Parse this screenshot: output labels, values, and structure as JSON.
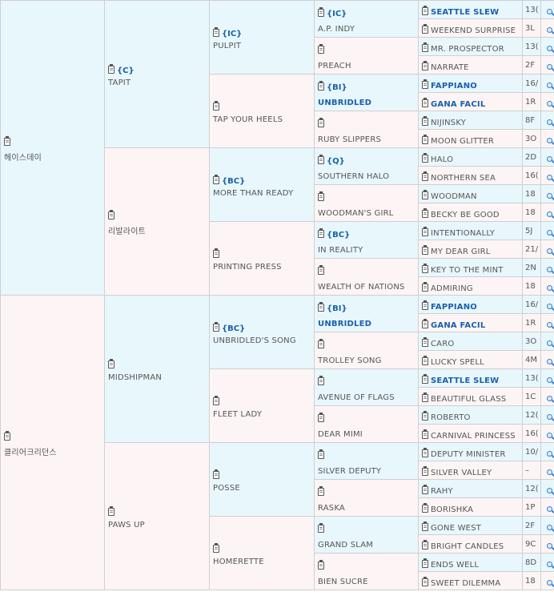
{
  "gen1": [
    {
      "name": "헤이스데이",
      "tag": "",
      "sex": "m"
    },
    {
      "name": "클리어크리던스",
      "tag": "",
      "sex": "f"
    }
  ],
  "gen2": [
    {
      "name": "TAPIT",
      "tag": "{C}",
      "sex": "m"
    },
    {
      "name": "리발라이트",
      "tag": "",
      "sex": "f"
    },
    {
      "name": "MIDSHIPMAN",
      "tag": "",
      "sex": "m"
    },
    {
      "name": "PAWS UP",
      "tag": "",
      "sex": "f"
    }
  ],
  "gen3": [
    {
      "name": "PULPIT",
      "tag": "{IC}",
      "sex": "m"
    },
    {
      "name": "TAP YOUR HEELS",
      "tag": "",
      "sex": "f"
    },
    {
      "name": "MORE THAN READY",
      "tag": "{BC}",
      "sex": "m"
    },
    {
      "name": "PRINTING PRESS",
      "tag": "",
      "sex": "f"
    },
    {
      "name": "UNBRIDLED'S SONG",
      "tag": "{BC}",
      "sex": "m"
    },
    {
      "name": "FLEET LADY",
      "tag": "",
      "sex": "f"
    },
    {
      "name": "POSSE",
      "tag": "",
      "sex": "m"
    },
    {
      "name": "HOMERETTE",
      "tag": "",
      "sex": "f"
    }
  ],
  "gen4": [
    {
      "name": "A.P. INDY",
      "tag": "{IC}",
      "sex": "m",
      "blue": false
    },
    {
      "name": "PREACH",
      "tag": "",
      "sex": "f",
      "blue": false
    },
    {
      "name": "UNBRIDLED",
      "tag": "{BI}",
      "sex": "m",
      "blue": true
    },
    {
      "name": "RUBY SLIPPERS",
      "tag": "",
      "sex": "f",
      "blue": false
    },
    {
      "name": "SOUTHERN HALO",
      "tag": "{Q}",
      "sex": "m",
      "blue": false
    },
    {
      "name": "WOODMAN'S GIRL",
      "tag": "",
      "sex": "f",
      "blue": false
    },
    {
      "name": "IN REALITY",
      "tag": "{BC}",
      "sex": "m",
      "blue": false
    },
    {
      "name": "WEALTH OF NATIONS",
      "tag": "",
      "sex": "f",
      "blue": false
    },
    {
      "name": "UNBRIDLED",
      "tag": "{BI}",
      "sex": "m",
      "blue": true
    },
    {
      "name": "TROLLEY SONG",
      "tag": "",
      "sex": "f",
      "blue": false
    },
    {
      "name": "AVENUE OF FLAGS",
      "tag": "",
      "sex": "m",
      "blue": false
    },
    {
      "name": "DEAR MIMI",
      "tag": "",
      "sex": "f",
      "blue": false
    },
    {
      "name": "SILVER DEPUTY",
      "tag": "",
      "sex": "m",
      "blue": false
    },
    {
      "name": "RASKA",
      "tag": "",
      "sex": "f",
      "blue": false
    },
    {
      "name": "GRAND SLAM",
      "tag": "",
      "sex": "m",
      "blue": false
    },
    {
      "name": "BIEN SUCRE",
      "tag": "",
      "sex": "f",
      "blue": false
    }
  ],
  "gen5": [
    {
      "name": "SEATTLE SLEW",
      "rec": "13(",
      "sex": "m",
      "blue": true
    },
    {
      "name": "WEEKEND SURPRISE",
      "rec": "3L",
      "sex": "f",
      "blue": false
    },
    {
      "name": "MR. PROSPECTOR",
      "rec": "13(",
      "sex": "m",
      "blue": false
    },
    {
      "name": "NARRATE",
      "rec": "2F",
      "sex": "f",
      "blue": false
    },
    {
      "name": "FAPPIANO",
      "rec": "16/",
      "sex": "m",
      "blue": true
    },
    {
      "name": "GANA FACIL",
      "rec": "1R",
      "sex": "f",
      "blue": true
    },
    {
      "name": "NIJINSKY",
      "rec": "8F",
      "sex": "m",
      "blue": false
    },
    {
      "name": "MOON GLITTER",
      "rec": "3O",
      "sex": "f",
      "blue": false
    },
    {
      "name": "HALO",
      "rec": "2D",
      "sex": "m",
      "blue": false
    },
    {
      "name": "NORTHERN SEA",
      "rec": "16(",
      "sex": "f",
      "blue": false
    },
    {
      "name": "WOODMAN",
      "rec": "18",
      "sex": "m",
      "blue": false
    },
    {
      "name": "BECKY BE GOOD",
      "rec": "18",
      "sex": "f",
      "blue": false
    },
    {
      "name": "INTENTIONALLY",
      "rec": "5J",
      "sex": "m",
      "blue": false
    },
    {
      "name": "MY DEAR GIRL",
      "rec": "21/",
      "sex": "f",
      "blue": false
    },
    {
      "name": "KEY TO THE MINT",
      "rec": "2N",
      "sex": "m",
      "blue": false
    },
    {
      "name": "ADMIRING",
      "rec": "18",
      "sex": "f",
      "blue": false
    },
    {
      "name": "FAPPIANO",
      "rec": "16/",
      "sex": "m",
      "blue": true
    },
    {
      "name": "GANA FACIL",
      "rec": "1R",
      "sex": "f",
      "blue": true
    },
    {
      "name": "CARO",
      "rec": "3O",
      "sex": "m",
      "blue": false
    },
    {
      "name": "LUCKY SPELL",
      "rec": "4M",
      "sex": "f",
      "blue": false
    },
    {
      "name": "SEATTLE SLEW",
      "rec": "13(",
      "sex": "m",
      "blue": true
    },
    {
      "name": "BEAUTIFUL GLASS",
      "rec": "1C",
      "sex": "f",
      "blue": false
    },
    {
      "name": "ROBERTO",
      "rec": "12(",
      "sex": "m",
      "blue": false
    },
    {
      "name": "CARNIVAL PRINCESS",
      "rec": "16(",
      "sex": "f",
      "blue": false
    },
    {
      "name": "DEPUTY MINISTER",
      "rec": "10/",
      "sex": "m",
      "blue": false
    },
    {
      "name": "SILVER VALLEY",
      "rec": "–",
      "sex": "f",
      "blue": false
    },
    {
      "name": "RAHY",
      "rec": "12(",
      "sex": "m",
      "blue": false
    },
    {
      "name": "BORISHKA",
      "rec": "1P",
      "sex": "f",
      "blue": false
    },
    {
      "name": "GONE WEST",
      "rec": "2F",
      "sex": "m",
      "blue": false
    },
    {
      "name": "BRIGHT CANDLES",
      "rec": "9C",
      "sex": "f",
      "blue": false
    },
    {
      "name": "ENDS WELL",
      "rec": "8D",
      "sex": "m",
      "blue": false
    },
    {
      "name": "SWEET DILEMMA",
      "rec": "18",
      "sex": "f",
      "blue": false
    }
  ],
  "colors": {
    "sire_bg": "#e8f7fc",
    "dam_bg": "#fdf5f5",
    "link": "#1a5fae"
  },
  "icons": {
    "pedigree": "clipboard-icon",
    "search": "magnifier-icon"
  }
}
